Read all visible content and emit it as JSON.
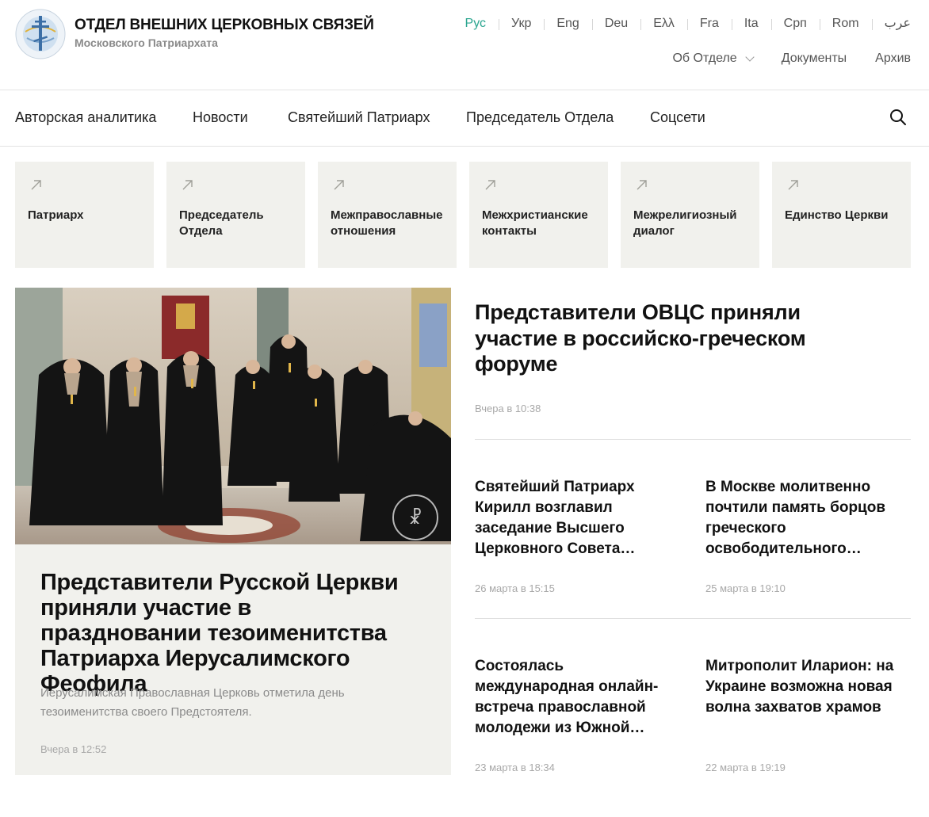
{
  "header": {
    "title": "ОТДЕЛ ВНЕШНИХ ЦЕРКОВНЫХ СВЯЗЕЙ",
    "subtitle": "Московского Патриархата",
    "logo_icon": "cross-globe-logo-icon"
  },
  "languages": [
    {
      "label": "Рус",
      "active": true
    },
    {
      "label": "Укр",
      "active": false
    },
    {
      "label": "Eng",
      "active": false
    },
    {
      "label": "Deu",
      "active": false
    },
    {
      "label": "Ελλ",
      "active": false
    },
    {
      "label": "Fra",
      "active": false
    },
    {
      "label": "Ita",
      "active": false
    },
    {
      "label": "Срп",
      "active": false
    },
    {
      "label": "Rom",
      "active": false
    },
    {
      "label": "عرب",
      "active": false
    }
  ],
  "topnav": {
    "about": "Об Отделе",
    "documents": "Документы",
    "archive": "Архив"
  },
  "mainnav": {
    "items": [
      "Авторская аналитика",
      "Новости",
      "Святейший Патриарх",
      "Председатель Отдела",
      "Соцсети"
    ],
    "search_icon": "search-icon"
  },
  "tiles": [
    "Патриарх",
    "Председатель Отдела",
    "Межправославные отношения",
    "Межхристианские контакты",
    "Межрелигиозный диалог",
    "Единство Церкви"
  ],
  "featured": {
    "title": "Представители Русской Церкви приняли участие в праздновании тезоименитства Патриарха Иерусалимского Феофила",
    "lead": "Иерусалимская Православная Церковь отметила день тезоименитства своего Предстоятеля.",
    "date": "Вчера в 12:52"
  },
  "main_story": {
    "title": "Представители ОВЦС приняли участие в российско-греческом форуме",
    "date": "Вчера в 10:38"
  },
  "stories": [
    {
      "title": "Святейший Патриарх Кирилл возглавил заседание Высшего Церковного Совета…",
      "date": "26 марта в 15:15"
    },
    {
      "title": "В Москве молитвенно почтили память борцов греческого освободительного…",
      "date": "25 марта в 19:10"
    },
    {
      "title": "Состоялась международная онлайн-встреча православной молодежи из Южной…",
      "date": "23 марта в 18:34"
    },
    {
      "title": "Митрополит Иларион: на Украине возможна новая волна захватов храмов",
      "date": "22 марта в 19:19"
    }
  ],
  "colors": {
    "accent": "#2aa58f",
    "tile_bg": "#f1f1ed",
    "muted_text": "#8a8a8a"
  }
}
